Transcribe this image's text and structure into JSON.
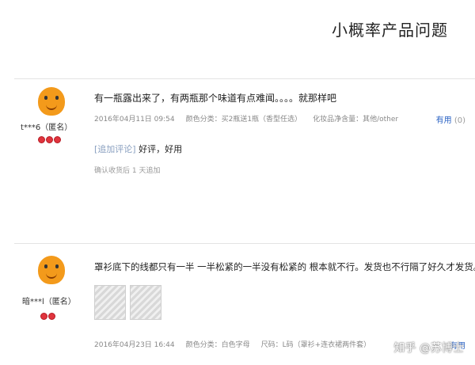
{
  "slide": {
    "title": "小概率产品问题"
  },
  "reviews": [
    {
      "username": "t***6（匿名）",
      "text": "有一瓶露出来了，有两瓶那个味道有点难闻。。。。就那样吧",
      "date": "2016年04月11日 09:54",
      "category": "颜色分类：买2瓶送1瓶（香型任选）",
      "spec": "化妆品净含量：其他/other",
      "useful_label": "有用",
      "useful_count": "(0)",
      "append_label": "[追加评论]",
      "append_text": "好评，好用",
      "append_note": "确认收货后 1 天追加"
    },
    {
      "username": "暗***l（匿名）",
      "text": "罩衫底下的线都只有一半 一半松紧的一半没有松紧的 根本就不行。发货也不行隔了好久才发货。",
      "date": "2016年04月23日 16:44",
      "category": "颜色分类：白色字母",
      "spec": "尺码：L码（罩衫+连衣裙两件套）",
      "useful_label": "有用"
    }
  ],
  "watermark": "知乎 @苏博士",
  "icons": {
    "avatar": "orange-mascot-avatar",
    "badge": "red-heart-badge"
  },
  "colors": {
    "useful_link": "#2b63c4",
    "badge_red": "#e0343d",
    "avatar_orange": "#f39a1b"
  }
}
